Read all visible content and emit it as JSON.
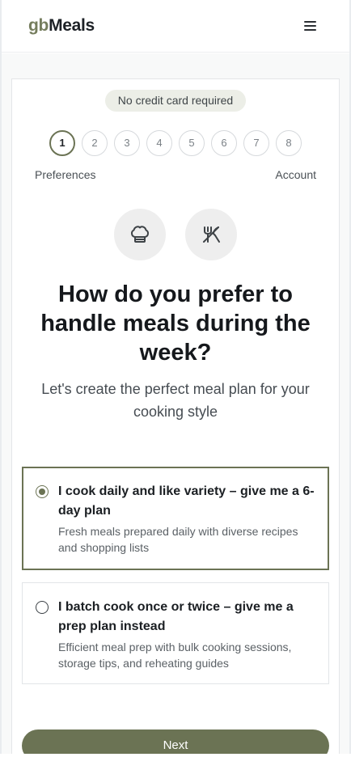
{
  "header": {
    "logo_prefix": "gb",
    "logo_suffix": "Meals",
    "menu_icon": "hamburger-menu-icon"
  },
  "badge": {
    "text": "No credit card required"
  },
  "steps": {
    "items": [
      "1",
      "2",
      "3",
      "4",
      "5",
      "6",
      "7",
      "8"
    ],
    "current": 1,
    "label_first": "Preferences",
    "label_last": "Account"
  },
  "icons": {
    "left": "chef-hat-icon",
    "right": "fork-knife-icon"
  },
  "question": {
    "title": "How do you prefer to handle meals during the week?",
    "subtitle": "Let's create the perfect meal plan for your cooking style"
  },
  "options": [
    {
      "title": "I cook daily and like variety – give me a 6-day plan",
      "description": "Fresh meals prepared daily with diverse recipes and shopping lists",
      "selected": true
    },
    {
      "title": "I batch cook once or twice – give me a prep plan instead",
      "description": "Efficient meal prep with bulk cooking sessions, storage tips, and reheating guides",
      "selected": false
    }
  ],
  "actions": {
    "next_label": "Next"
  },
  "colors": {
    "accent": "#6b7354",
    "logo_gb": "#757d5d",
    "badge_bg": "#eceee7"
  }
}
